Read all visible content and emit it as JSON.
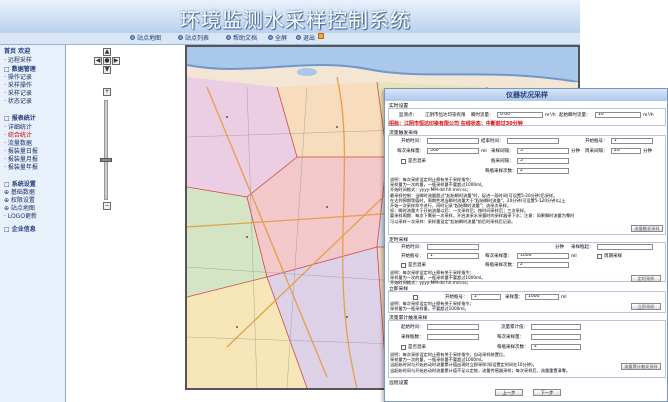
{
  "header": {
    "title": "环境监测水采样控制系统"
  },
  "menubar": {
    "items": [
      "站点地图",
      "站点列表",
      "帮助文档",
      "全屏",
      "退出"
    ]
  },
  "sidebar": {
    "items": [
      {
        "label": "首页  欢迎",
        "cls": "sec"
      },
      {
        "label": "· 远程采样",
        "cls": ""
      },
      {
        "label": "□ 数据管理",
        "cls": "sec"
      },
      {
        "label": "  · 操作记录",
        "cls": ""
      },
      {
        "label": "  · 采样操作",
        "cls": ""
      },
      {
        "label": "  · 采样记录",
        "cls": ""
      },
      {
        "label": "  · 状态记录",
        "cls": ""
      },
      {
        "label": "□ 报表统计",
        "cls": "sec"
      },
      {
        "label": "  · 详细统计",
        "cls": ""
      },
      {
        "label": "  · 综合统计",
        "cls": "red"
      },
      {
        "label": "  · 流量数据",
        "cls": ""
      },
      {
        "label": "  · 报装量日报",
        "cls": ""
      },
      {
        "label": "  · 报装量月报",
        "cls": ""
      },
      {
        "label": "  · 报装量年报",
        "cls": ""
      },
      {
        "label": "□ 系统设置",
        "cls": "sec"
      },
      {
        "label": "  ⊕ 基础数据",
        "cls": ""
      },
      {
        "label": "  ⊕ 权限设置",
        "cls": ""
      },
      {
        "label": "  ⊕ 站点地图",
        "cls": ""
      },
      {
        "label": "  · LOGO更新",
        "cls": ""
      },
      {
        "label": "□ 企业信息",
        "cls": "sec"
      }
    ]
  },
  "dialog": {
    "title": "仪器状况采样",
    "section1": "实时设置",
    "station_label": "监测点：",
    "station_value": "江阴市恒达印染有限",
    "flow_label": "瞬时流量：",
    "flow_value": "0.00",
    "flow_unit": "m³/h",
    "start_flow_label": "起始瞬时流量：",
    "start_flow_value": "10",
    "start_flow_unit": "m³/h",
    "status_line": "招标：江阴市恒达印染有限公司  在线状态：中断前过30分钟",
    "flow_sampling": "流量触发采样",
    "start_time": "开始时间：",
    "end_time": "结束时间：",
    "start_bottle": "开始瓶号：",
    "start_bottle_val": "1",
    "each_vol": "每次采样量：",
    "each_vol_val": "500",
    "each_unit": "ml",
    "interval": "采样间隔：",
    "interval_val": "5",
    "min_unit": "分钟",
    "cycle": "周采间隔：",
    "cycle_val": "20",
    "min_unit2": "分钟",
    "combine": "是否混采",
    "bottle_interval": "瓶采间隔：",
    "bottle_interval_val": "5",
    "times": "每瓶采样次数：",
    "times_val": "2",
    "note1": "说明：每次采样设定时止察有关于采样指令；\n采样量为一次的量，一瓶采样量不要超过1000ml。\n开始时间格式：yyyy-MM-dd hh:mm:ss；\n最采样控制：当瞬时流量超过\"起始瞬时流量\"时，促进一段时间(可设置5-20分钟)后采样。\n在达到预期等值时，周期性地当瞬时流量大于\"起始瞬时流量\"，20分钟(可设置5-120分钟)以上\n开始一次采样命令进行，同时记录\"起始瞬时流量\"；流采次采样。\n如：瞬时流量大于开始流量以后：一次采样后；按时间采样后；三次采样。\n要采样周期：每次下需采一次采样，开启流采水采量时的采样器采下水；注意：如果瞬时流量为零时\n可以采样一次采样：采样量设定\"起始瞬时流量\"前后时采样后记录。",
    "btn_flow": "流量触发采样",
    "timed_sampling": "定时采样",
    "start_time2": "开始时间：",
    "min_unit3": "分钟",
    "bottle_start": "采样瓶起：",
    "start_bottle2": "开始瓶号：",
    "start_bottle2_val": "1",
    "each_vol2": "每次采样量：",
    "each_vol2_val": "1000",
    "each_unit2": "ml",
    "cycle_chk": "周期采样",
    "combine2": "是否混采",
    "times2": "每瓶采样次数：",
    "times2_val": "2",
    "note2": "说明：每次采样设定时止察有关于采样指令；\n采样量为一次的量，一瓶采样量不要超过1000ml。\n开始时间格式：yyyy-MM-dd hh:mm:ss；",
    "btn_timed": "定时采样",
    "manual_sampling": "立即采样",
    "start_bottle3": "开始瓶号：",
    "start_bottle3_val": "1",
    "vol3": "采样量：",
    "vol3_val": "1000",
    "unit3": "ml",
    "note3": "说明：每次采样设定时止察有关于采样指令；\n采样量为一瓶采样量，不要超过1000ml。",
    "btn_manual": "立即采样",
    "flow_control": "流量累计触发采样",
    "start_time4": "起始时间：",
    "flow_acc": "流量累计值：",
    "bottle4": "采样瓶数：",
    "vol4": "每次采样量：",
    "combine4": "是否混采",
    "times4": "每瓶采样次数：",
    "times4_val": "2",
    "note4": "说明：每次采样设定时止察有关于采样指令；自动采样装置位。\n采样量为一次的量，一瓶采样量不要超过1000ml。\n当起始时间与开始启动时流量累计值出现时立即采样(如设置定时间在10分钟)。\n当起始时间与开始启动时流量累计值不足以定统，流量传感器采样；每次采样后，流量重置清零。",
    "btn_flowacc": "流量累计触发采样",
    "remote": "远程设置",
    "btn_prev": "上一步",
    "btn_next": "下一步"
  }
}
